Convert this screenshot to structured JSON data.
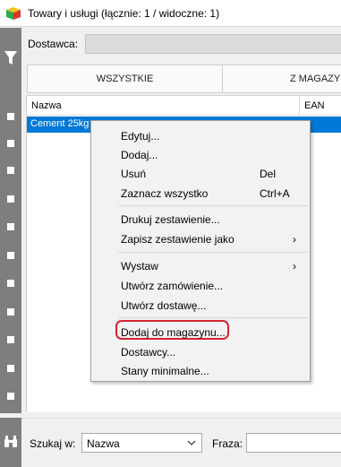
{
  "window": {
    "title": "Towary i usługi (łącznie: 1 / widoczne: 1)"
  },
  "filter": {
    "supplier_label": "Dostawca:",
    "supplier_value": ""
  },
  "tabs": [
    {
      "label": "WSZYSTKIE"
    },
    {
      "label": "Z MAGAZY"
    }
  ],
  "grid": {
    "columns": [
      {
        "label": "Nazwa"
      },
      {
        "label": "EAN"
      }
    ],
    "rows": [
      {
        "nazwa": "Cement 25kg",
        "ean": ""
      }
    ]
  },
  "context_menu": {
    "items": [
      {
        "label": "Edytuj..."
      },
      {
        "label": "Dodaj..."
      },
      {
        "label": "Usuń",
        "shortcut": "Del"
      },
      {
        "label": "Zaznacz wszystko",
        "shortcut": "Ctrl+A"
      },
      {
        "label": "Drukuj zestawienie..."
      },
      {
        "label": "Zapisz zestawienie jako",
        "submenu": "›"
      },
      {
        "label": "Wystaw",
        "submenu": "›"
      },
      {
        "label": "Utwórz zamówienie..."
      },
      {
        "label": "Utwórz dostawę..."
      },
      {
        "label": "Dodaj do magazynu..."
      },
      {
        "label": "Dostawcy..."
      },
      {
        "label": "Stany minimalne..."
      }
    ]
  },
  "search": {
    "label": "Szukaj w:",
    "field_value": "Nazwa",
    "phrase_label": "Fraza:",
    "phrase_value": ""
  },
  "colors": {
    "selection": "#0078d7",
    "highlight_ring": "#d6232f",
    "sidebar": "#7e7e7e"
  }
}
